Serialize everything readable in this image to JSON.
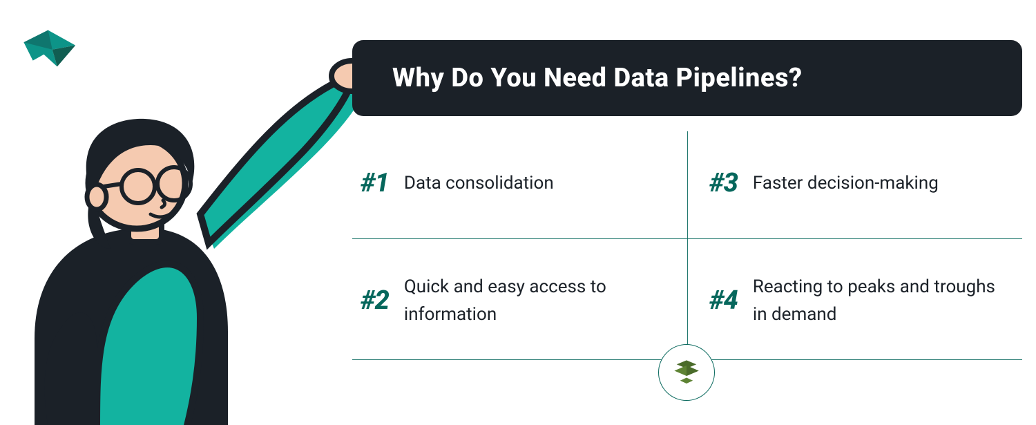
{
  "colors": {
    "panel_bg": "#1b2128",
    "accent": "#06675c",
    "teal": "#13b3a0",
    "skin": "#f5cab0",
    "text": "#1b2128"
  },
  "header": {
    "title": "Why Do You Need Data Pipelines?"
  },
  "items": [
    {
      "num": "#1",
      "text": "Data consolidation"
    },
    {
      "num": "#2",
      "text": "Quick and easy access to information"
    },
    {
      "num": "#3",
      "text": "Faster decision-making"
    },
    {
      "num": "#4",
      "text": "Reacting to peaks and troughs in demand"
    }
  ],
  "logo": {
    "name": "origami-bird-icon"
  },
  "badge": {
    "name": "stack-layers-icon",
    "color": "#5e8334"
  },
  "illustration": {
    "name": "person-holding-sign"
  }
}
